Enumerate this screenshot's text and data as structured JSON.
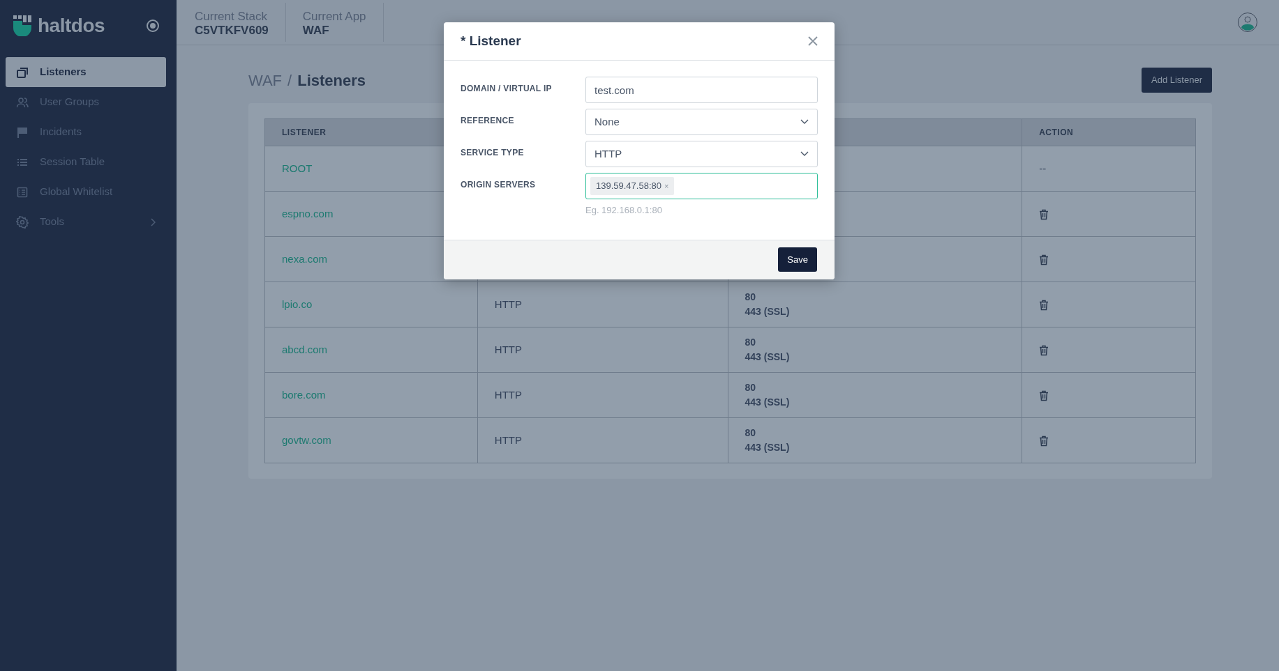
{
  "sidebar": {
    "brand": "haltdos",
    "items": [
      {
        "label": "Listeners",
        "selected": true,
        "expandable": false
      },
      {
        "label": "User Groups",
        "selected": false,
        "expandable": false
      },
      {
        "label": "Incidents",
        "selected": false,
        "expandable": false
      },
      {
        "label": "Session Table",
        "selected": false,
        "expandable": false
      },
      {
        "label": "Global Whitelist",
        "selected": false,
        "expandable": false
      },
      {
        "label": "Tools",
        "selected": false,
        "expandable": true
      }
    ]
  },
  "header": {
    "contexts": [
      {
        "label": "Current Stack",
        "value": "C5VTKFV609"
      },
      {
        "label": "Current App",
        "value": "WAF"
      }
    ]
  },
  "breadcrumb": {
    "items": [
      "WAF",
      "Listeners"
    ],
    "separator": "/"
  },
  "add_button": "Add Listener",
  "table": {
    "columns": [
      {
        "label": "LISTENER"
      },
      {},
      {},
      {
        "label": "ACTION"
      }
    ],
    "rows": [
      {
        "listener": "ROOT",
        "action": "--",
        "deletable": false
      },
      {
        "listener": "espno.com",
        "deletable": true
      },
      {
        "listener": "nexa.com",
        "deletable": true
      },
      {
        "listener": "lpio.co",
        "column_2": "HTTP",
        "column_3": [
          "80",
          "443 (SSL)"
        ],
        "deletable": true
      },
      {
        "listener": "abcd.com",
        "column_2": "HTTP",
        "column_3": [
          "80",
          "443 (SSL)"
        ],
        "deletable": true
      },
      {
        "listener": "bore.com",
        "column_2": "HTTP",
        "column_3": [
          "80",
          "443 (SSL)"
        ],
        "deletable": true
      },
      {
        "listener": "govtw.com",
        "column_2": "HTTP",
        "column_3": [
          "80",
          "443 (SSL)"
        ],
        "deletable": true
      }
    ]
  },
  "modal": {
    "title": "* Listener",
    "fields": [
      {
        "label": "DOMAIN / VIRTUAL IP",
        "kind": "text",
        "value": "test.com"
      },
      {
        "label": "REFERENCE",
        "kind": "select",
        "value": "None"
      },
      {
        "label": "SERVICE TYPE",
        "kind": "select",
        "value": "HTTP"
      },
      {
        "label": "ORIGIN SERVERS",
        "kind": "tags",
        "tags": [
          {
            "text": "139.59.47.58:80",
            "remove": "×"
          }
        ],
        "hint": "Eg. 192.168.0.1:80",
        "focused": true
      }
    ],
    "save": "Save"
  }
}
